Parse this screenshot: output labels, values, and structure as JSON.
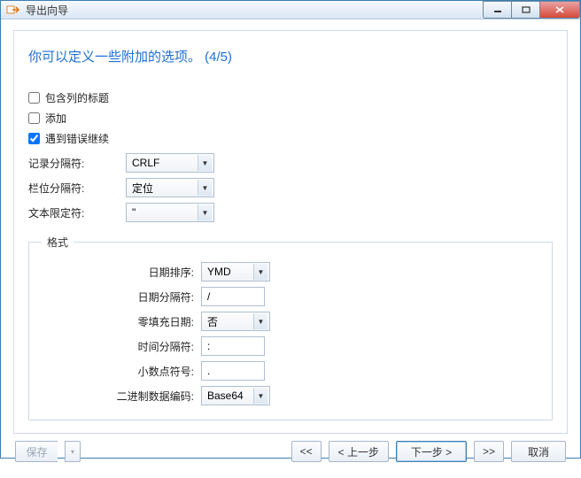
{
  "window": {
    "title": "导出向导"
  },
  "heading": "你可以定义一些附加的选项。 (4/5)",
  "checks": {
    "include_titles": {
      "label": "包含列的标题",
      "checked": false
    },
    "append": {
      "label": "添加",
      "checked": false
    },
    "continue_error": {
      "label": "遇到错误继续",
      "checked": true
    }
  },
  "separators": {
    "record": {
      "label": "记录分隔符:",
      "value": "CRLF"
    },
    "field": {
      "label": "栏位分隔符:",
      "value": "定位"
    },
    "text": {
      "label": "文本限定符:",
      "value": "\""
    }
  },
  "format": {
    "legend": "格式",
    "date_order": {
      "label": "日期排序:",
      "value": "YMD"
    },
    "date_sep": {
      "label": "日期分隔符:",
      "value": "/"
    },
    "zero_fill": {
      "label": "零填充日期:",
      "value": "否"
    },
    "time_sep": {
      "label": "时间分隔符:",
      "value": ":"
    },
    "decimal": {
      "label": "小数点符号:",
      "value": "."
    },
    "binary_enc": {
      "label": "二进制数据编码:",
      "value": "Base64"
    }
  },
  "buttons": {
    "save": "保存",
    "first": "<<",
    "prev": "< 上一步",
    "next": "下一步 >",
    "last": ">>",
    "cancel": "取消"
  }
}
